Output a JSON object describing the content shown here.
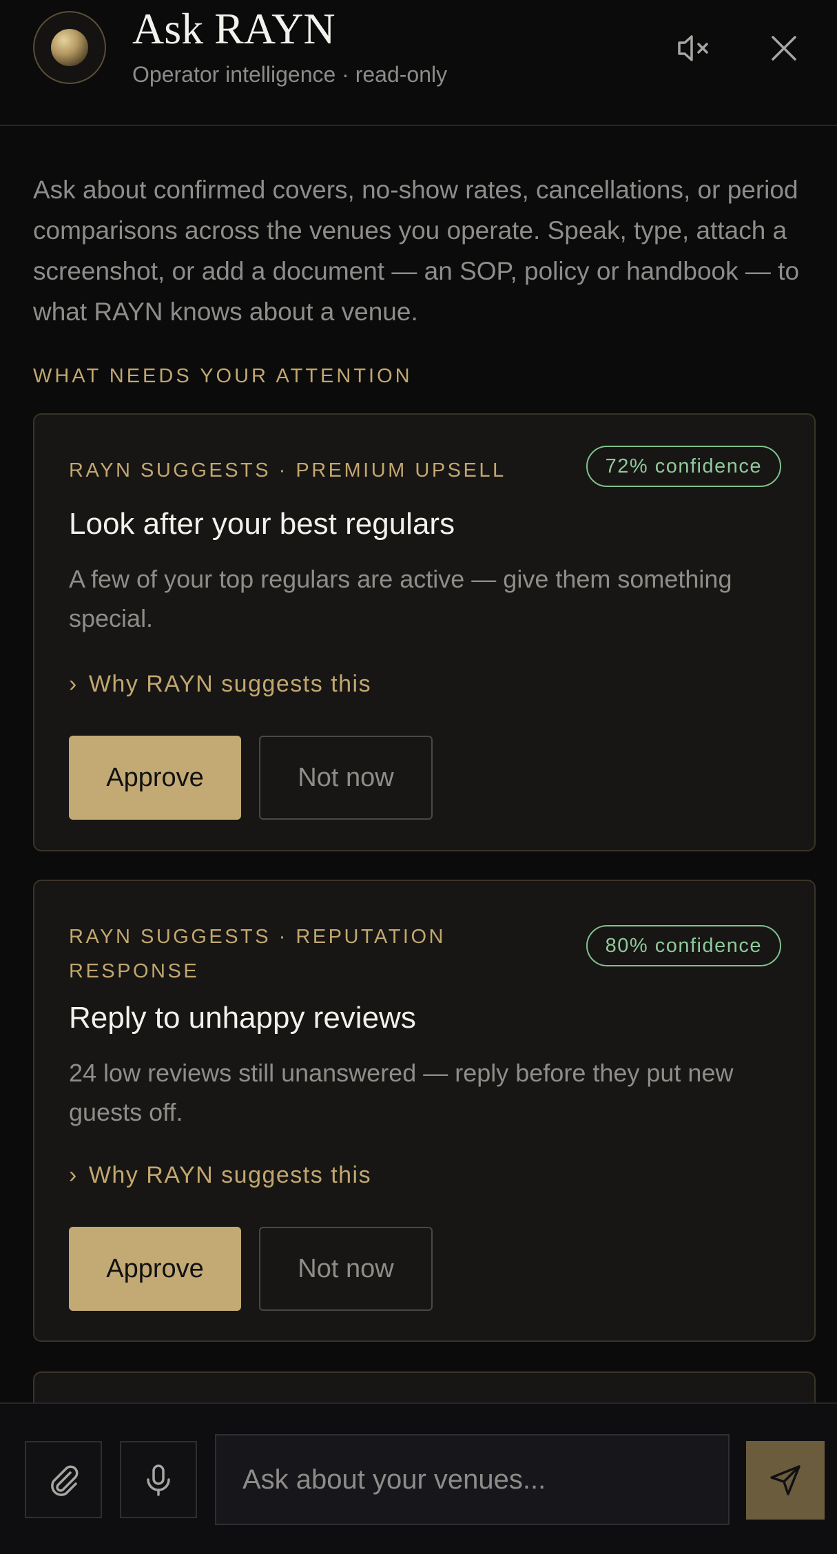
{
  "header": {
    "title": "Ask RAYN",
    "subtitle": "Operator intelligence · read-only"
  },
  "intro": "Ask about confirmed covers, no-show rates, cancellations, or period comparisons across the venues you operate. Speak, type, attach a screenshot, or add a document — an SOP, policy or handbook — to what RAYN knows about a venue.",
  "section_label": "WHAT NEEDS YOUR ATTENTION",
  "cards": [
    {
      "tag": "RAYN SUGGESTS · PREMIUM UPSELL",
      "confidence": "72% confidence",
      "title": "Look after your best regulars",
      "description": "A few of your top regulars are active — give them something special.",
      "why": "Why RAYN suggests this",
      "approve": "Approve",
      "dismiss": "Not now"
    },
    {
      "tag": "RAYN SUGGESTS · REPUTATION RESPONSE",
      "confidence": "80% confidence",
      "title": "Reply to unhappy reviews",
      "description": "24 low reviews still unanswered — reply before they put new guests off.",
      "why": "Why RAYN suggests this",
      "approve": "Approve",
      "dismiss": "Not now"
    }
  ],
  "composer": {
    "placeholder": "Ask about your venues..."
  },
  "icons": {
    "mute": "speaker-muted-icon",
    "close": "close-icon",
    "attach": "paperclip-icon",
    "mic": "microphone-icon",
    "send": "send-icon",
    "why": "chevron-right-icon"
  },
  "colors": {
    "background": "#0b0b0c",
    "accent": "#c3aa74",
    "confidence": "#8fc99a",
    "send": "#6b5c3e"
  }
}
